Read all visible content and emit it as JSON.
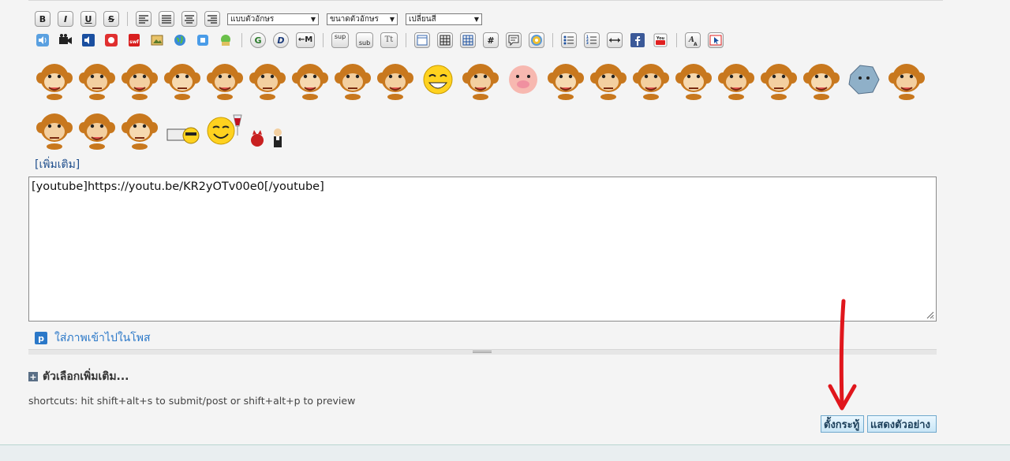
{
  "toolbar": {
    "row1": {
      "bold": "B",
      "italic": "I",
      "underline": "U",
      "strike": "S",
      "font_select": "แบบตัวอักษร",
      "size_select": "ขนาดตัวอักษร",
      "color_select": "เปลี่ยนสี"
    },
    "row2": {
      "gtag": "G",
      "dtag": "D",
      "mtag": "←M",
      "sup": "sup",
      "sub": "sub",
      "tt": "Tt",
      "hash": "#"
    }
  },
  "more_emoticons": "[เพิ่มเติม]",
  "editor": {
    "value": "[youtube]https://youtu.be/KR2yOTv00e0[/youtube]"
  },
  "insert_image": "ใส่ภาพเข้าไปในโพส",
  "more_options": "ตัวเลือกเพิ่มเติม...",
  "shortcuts": "shortcuts: hit shift+alt+s to submit/post or shift+alt+p to preview",
  "buttons": {
    "post": "ตั้งกระทู้",
    "preview": "แสดงตัวอย่าง"
  },
  "colors": {
    "link": "#1f4e8c",
    "arrow": "#e0161c",
    "button_bg": "#c9e6f6"
  }
}
